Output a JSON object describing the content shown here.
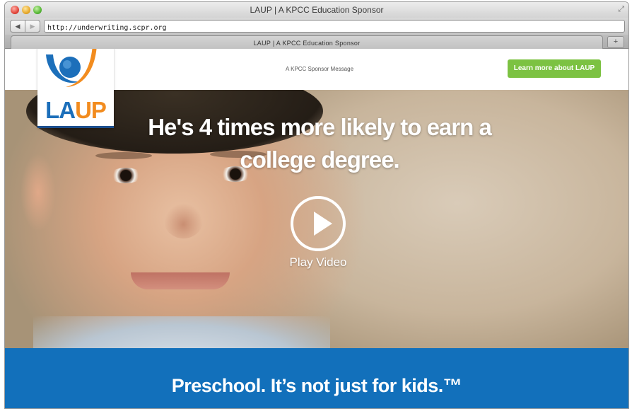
{
  "window": {
    "title": "LAUP | A KPCC Education Sponsor",
    "url": "http://underwriting.scpr.org",
    "tab_title": "LAUP | A KPCC Education Sponsor",
    "new_tab_icon": "plus-icon"
  },
  "header": {
    "logo": {
      "la": "LA",
      "up": "UP"
    },
    "sponsor_message": "A KPCC Sponsor Message",
    "cta_label": "Learn more about LAUP"
  },
  "hero": {
    "headline": "He's 4 times more likely to earn a college degree.",
    "play_label": "Play Video"
  },
  "footer": {
    "tagline": "Preschool. It’s not just for kids.™"
  },
  "colors": {
    "cta_green": "#7cc242",
    "brand_blue": "#1270bb",
    "brand_orange": "#f28c1f"
  }
}
